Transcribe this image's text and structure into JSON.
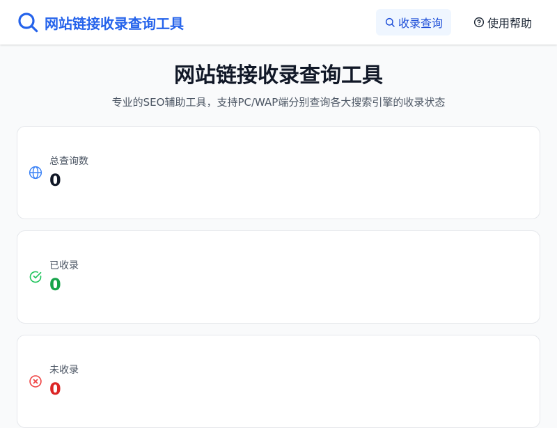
{
  "header": {
    "title": "网站链接收录查询工具",
    "logo_icon": "search-icon",
    "nav": [
      {
        "label": "收录查询",
        "icon": "search-icon",
        "active": true
      },
      {
        "label": "使用帮助",
        "icon": "help-circle-icon",
        "active": false
      }
    ]
  },
  "hero": {
    "title": "网站链接收录查询工具",
    "subtitle": "专业的SEO辅助工具，支持PC/WAP端分别查询各大搜索引擎的收录状态"
  },
  "stats": [
    {
      "label": "总查询数",
      "value": "0",
      "icon": "globe-icon",
      "color": "#111827",
      "icon_color": "#3b82f6"
    },
    {
      "label": "已收录",
      "value": "0",
      "icon": "check-circle-icon",
      "color": "#16a34a",
      "icon_color": "#22c55e"
    },
    {
      "label": "未收录",
      "value": "0",
      "icon": "x-circle-icon",
      "color": "#dc2626",
      "icon_color": "#ef4444"
    }
  ],
  "colors": {
    "brand": "#2563eb",
    "nav_active_bg": "#eff6ff"
  }
}
